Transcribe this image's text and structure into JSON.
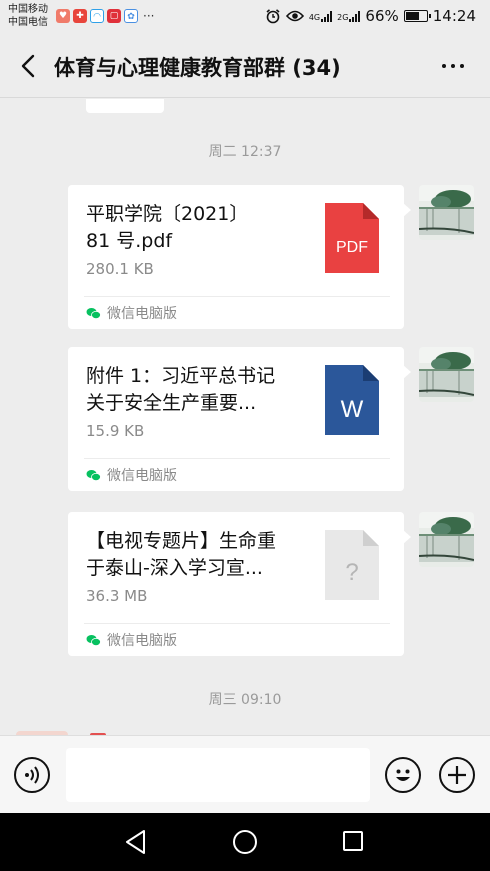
{
  "status_bar": {
    "carrier1": "中国移动",
    "carrier2": "中国电信",
    "network1": "4G",
    "network2": "2G",
    "battery": "66%",
    "battery_level": 0.66,
    "time": "14:24",
    "app_icons": [
      {
        "name": "health-app-icon",
        "color": "#f07b6a"
      },
      {
        "name": "gift-app-icon",
        "color": "#e8453c"
      },
      {
        "name": "arc-app-icon",
        "color": "#2ea0e8"
      },
      {
        "name": "red-square-app-icon",
        "color": "#e0303a"
      },
      {
        "name": "flower-app-icon",
        "color": "#4a90e2"
      }
    ],
    "more_indicator": "···"
  },
  "header": {
    "title": "体育与心理健康教育部群 (34)"
  },
  "chat": {
    "timestamps": [
      "周二 12:37",
      "周三 09:10"
    ],
    "messages": [
      {
        "name_line1": "平职学院〔2021〕",
        "name_line2": "81 号.pdf",
        "size": "280.1 KB",
        "icon_type": "pdf",
        "icon_label": "PDF",
        "icon_color": "#e94141",
        "source": "微信电脑版"
      },
      {
        "name_line1": "附件 1：习近平总书记",
        "name_line2": "关于安全生产重要...",
        "size": "15.9 KB",
        "icon_type": "word",
        "icon_label": "W",
        "icon_color": "#2b579a",
        "source": "微信电脑版"
      },
      {
        "name_line1": "【电视专题片】生命重",
        "name_line2": "于泰山-深入学习宣...",
        "size": "36.3 MB",
        "icon_type": "unknown",
        "icon_label": "?",
        "icon_color": "#e8e8e8",
        "source": "微信电脑版"
      }
    ]
  },
  "input_bar": {
    "placeholder": ""
  },
  "colors": {
    "background": "#ededed",
    "bubble": "#ffffff",
    "wechat_green": "#07c160"
  }
}
